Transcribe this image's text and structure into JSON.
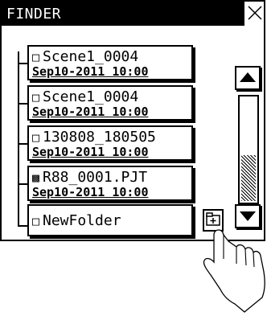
{
  "window": {
    "title": "FINDER"
  },
  "items": [
    {
      "name": "Scene1_0004",
      "date": "Sep10-2011 10:00",
      "icon": "file-icon"
    },
    {
      "name": "Scene1_0004",
      "date": "Sep10-2011 10:00",
      "icon": "file-icon"
    },
    {
      "name": "130808_180505",
      "date": "Sep10-2011 10:00",
      "icon": "file-icon"
    },
    {
      "name": "R88_0001.PJT",
      "date": "Sep10-2011 10:00",
      "icon": "project-file-icon"
    }
  ],
  "folder": {
    "name": "NewFolder",
    "icon": "folder-icon"
  },
  "scrollbar": {
    "thumb_fraction": 0.45
  },
  "controls": {
    "new_folder": "new-folder-icon",
    "close": "close-icon",
    "up": "arrow-up-icon",
    "down": "arrow-down-icon"
  }
}
